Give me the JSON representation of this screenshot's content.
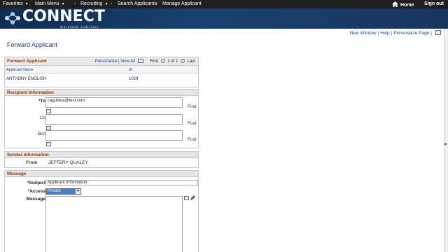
{
  "topnav": {
    "favorites": "Favorites",
    "main_menu": "Main Menu",
    "recruiting": "Recruiting",
    "search_applicants": "Search Applicants",
    "manage_applicant": "Manage Applicant",
    "home": "Home",
    "sign_out": "Sign out"
  },
  "brand": {
    "name": "CONNECT",
    "subtitle": "Maryland Judiciary"
  },
  "pagelinks": {
    "new_window": "New Window",
    "help": "Help",
    "personalize_page": "Personalize Page"
  },
  "page": {
    "title": "Forward Applicant"
  },
  "applicant_grid": {
    "title": "Forward Applicant",
    "personalize": "Personalize",
    "view_all": "View All",
    "first": "First",
    "pager": "1 of 1",
    "last": "Last",
    "columns": [
      "Applicant Name",
      "ID"
    ],
    "rows": [
      {
        "name": "ANTHONY ENGLISH",
        "id": "1029"
      }
    ]
  },
  "recipient": {
    "title": "Recipient Information",
    "to_label": "*To",
    "to_value": "caguilera@test.com",
    "cc_label": "Cc",
    "cc_value": "",
    "bcc_label": "Bcc",
    "bcc_value": "",
    "find": "Find"
  },
  "sender": {
    "title": "Sender Information",
    "from_label": "From",
    "from_value": "JEFFERY QUALEY"
  },
  "message": {
    "title": "Message",
    "subject_label": "*Subject",
    "subject_value": "Applicant Information",
    "access_label": "*Access",
    "access_value": "Private",
    "message_label": "Message",
    "message_value": ""
  },
  "colors": {
    "nav_bg": "#1f1f1f",
    "banner_bg": "#1a4170",
    "section_title": "#8b3a16",
    "link": "#1a3f8f",
    "select_bg": "#3f7fd4"
  }
}
